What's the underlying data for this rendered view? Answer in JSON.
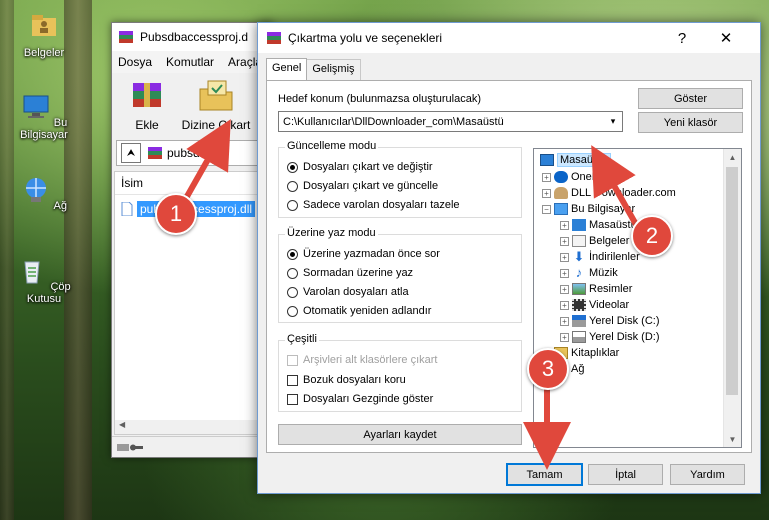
{
  "desktop": {
    "icons": [
      {
        "label": "Belgeler"
      },
      {
        "label": "Bu Bilgisayar"
      },
      {
        "label": "Ağ"
      },
      {
        "label": "Çöp Kutusu"
      }
    ]
  },
  "back_window": {
    "title": "Pubsdbaccessproj.d",
    "menu": [
      "Dosya",
      "Komutlar",
      "Araçla"
    ],
    "tools": {
      "add": "Ekle",
      "extract": "Dizine Çıkart"
    },
    "address": "pubsdbacc",
    "column_name": "İsim",
    "file": "pubsdbaccessproj.dll"
  },
  "dialog": {
    "title": "Çıkartma yolu ve seçenekleri",
    "help_btn": "?",
    "close_btn": "✕",
    "tabs": [
      "Genel",
      "Gelişmiş"
    ],
    "dest_label": "Hedef konum (bulunmazsa oluşturulacak)",
    "dest_value": "C:\\Kullanıcılar\\DllDownloader_com\\Masaüstü",
    "show_btn": "Göster",
    "new_folder_btn": "Yeni klasör",
    "update_mode": {
      "title": "Güncelleme modu",
      "options": [
        "Dosyaları çıkart ve değiştir",
        "Dosyaları çıkart ve güncelle",
        "Sadece varolan dosyaları tazele"
      ],
      "selected": 0
    },
    "overwrite_mode": {
      "title": "Üzerine yaz modu",
      "options": [
        "Üzerine yazmadan önce sor",
        "Sormadan üzerine yaz",
        "Varolan dosyaları atla",
        "Otomatik yeniden adlandır"
      ],
      "selected": 0
    },
    "misc": {
      "title": "Çeşitli",
      "options": [
        "Arşivleri alt klasörlere çıkart",
        "Bozuk dosyaları koru",
        "Dosyaları Gezginde göster"
      ]
    },
    "save_btn": "Ayarları kaydet",
    "tree": [
      {
        "label": "Masaüstü",
        "icon": "desktop-icon",
        "selected": true
      },
      {
        "label": "OneDrive",
        "icon": "cloud-icon"
      },
      {
        "label": "DLL Downloader.com",
        "icon": "user-icon"
      },
      {
        "label": "Bu Bilgisayar",
        "icon": "computer-icon"
      },
      {
        "label": "Masaüstü",
        "icon": "desktop-icon"
      },
      {
        "label": "Belgeler",
        "icon": "documents-icon"
      },
      {
        "label": "İndirilenler",
        "icon": "download-icon"
      },
      {
        "label": "Müzik",
        "icon": "music-icon"
      },
      {
        "label": "Resimler",
        "icon": "pictures-icon"
      },
      {
        "label": "Videolar",
        "icon": "video-icon"
      },
      {
        "label": "Yerel Disk (C:)",
        "icon": "drive-icon"
      },
      {
        "label": "Yerel Disk (D:)",
        "icon": "drive-icon"
      },
      {
        "label": "Kitaplıklar",
        "icon": "library-icon"
      },
      {
        "label": "Ağ",
        "icon": "network-icon"
      }
    ],
    "ok_btn": "Tamam",
    "cancel_btn": "İptal",
    "help_btn2": "Yardım"
  },
  "annotations": [
    "1",
    "2",
    "3"
  ],
  "colors": {
    "arrow": "#e0483c",
    "selection": "#3399ff",
    "accent": "#0078d7"
  }
}
